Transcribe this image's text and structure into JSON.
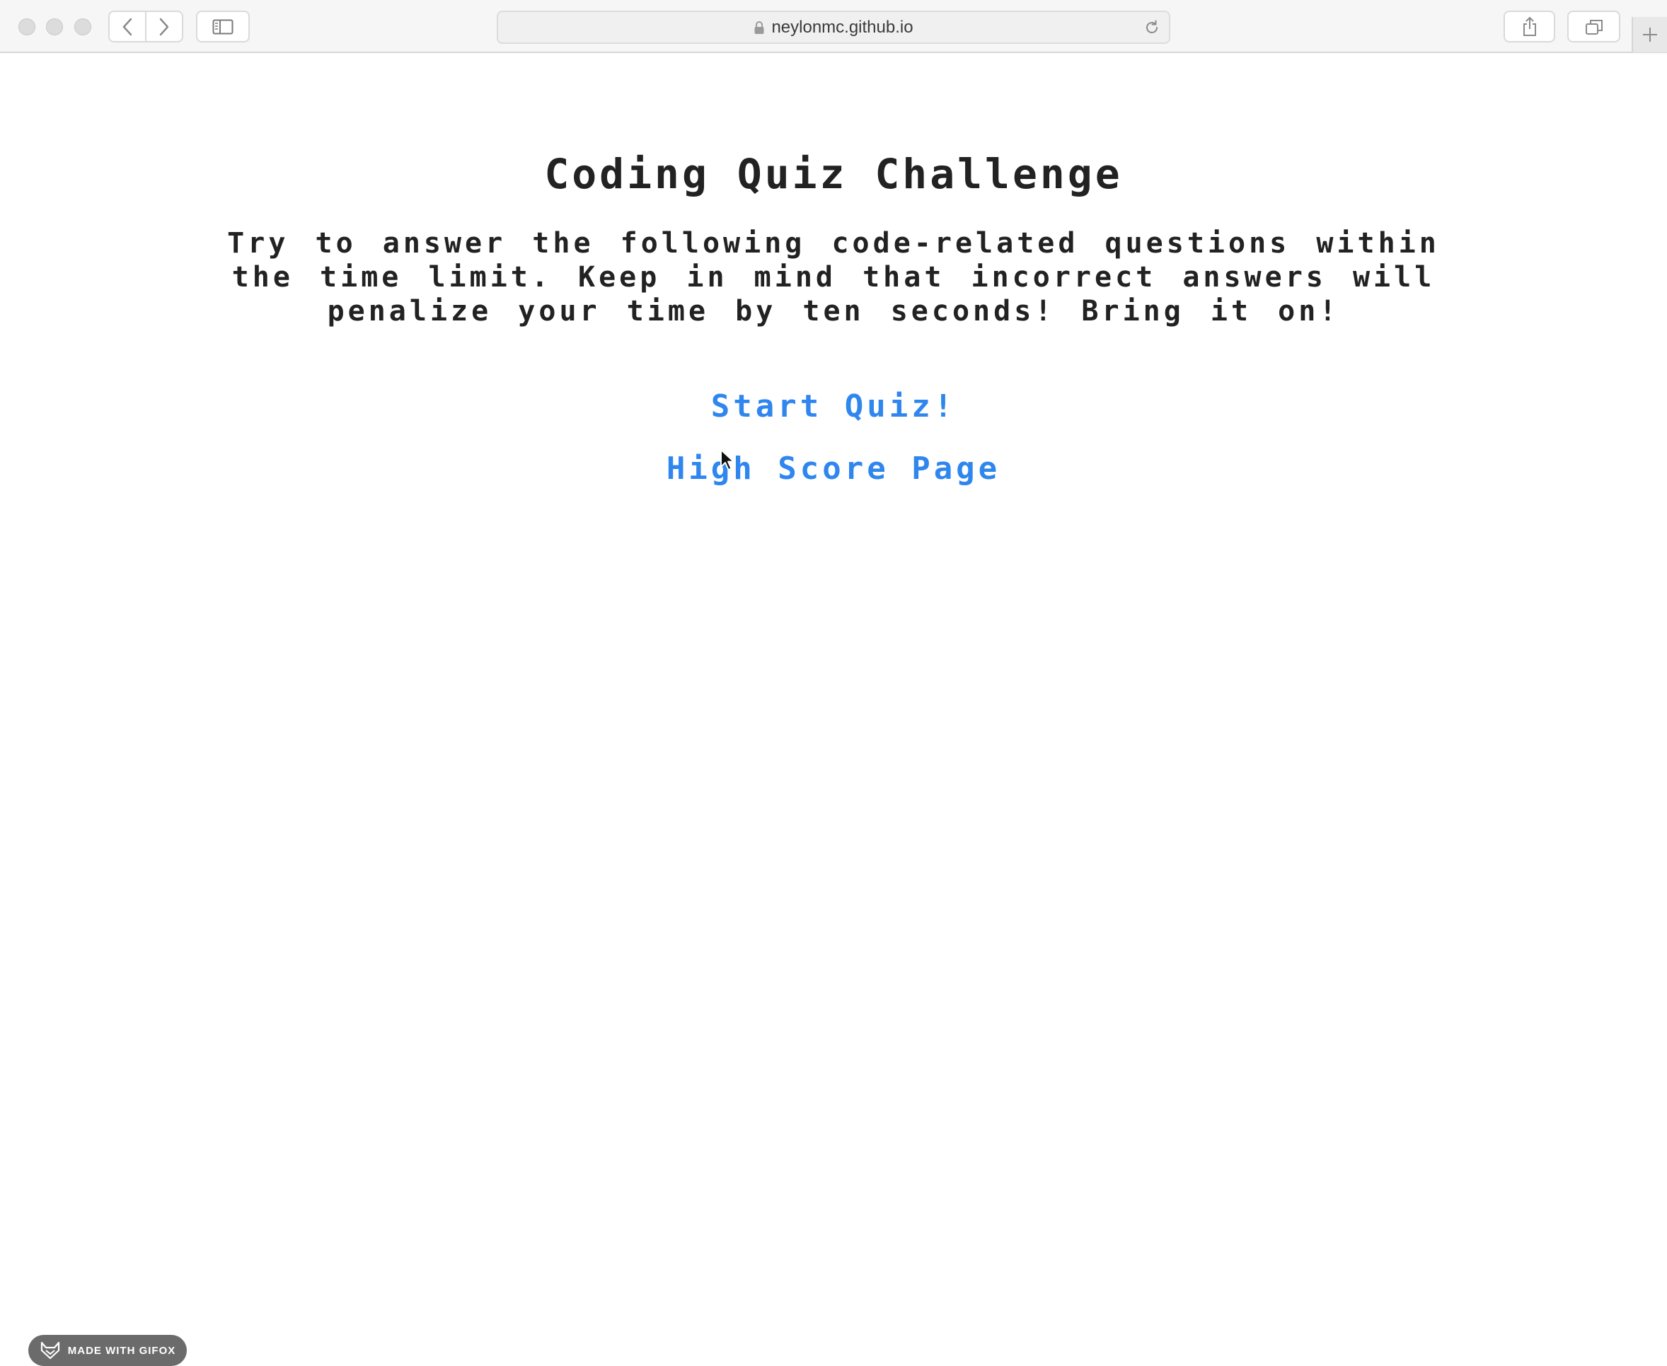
{
  "browser": {
    "url": "neylonmc.github.io"
  },
  "page": {
    "title": "Coding Quiz Challenge",
    "intro": "Try to answer the following code-related questions within the time limit. Keep in mind that incorrect answers will penalize your time by ten seconds! Bring it on!",
    "start_link": "Start Quiz!",
    "highscore_link": "High Score Page"
  },
  "watermark": {
    "label": "MADE WITH GIFOX",
    "icon": "fox-icon"
  },
  "colors": {
    "link": "#2f86ee",
    "text": "#222222",
    "toolbar": "#f6f6f6"
  }
}
